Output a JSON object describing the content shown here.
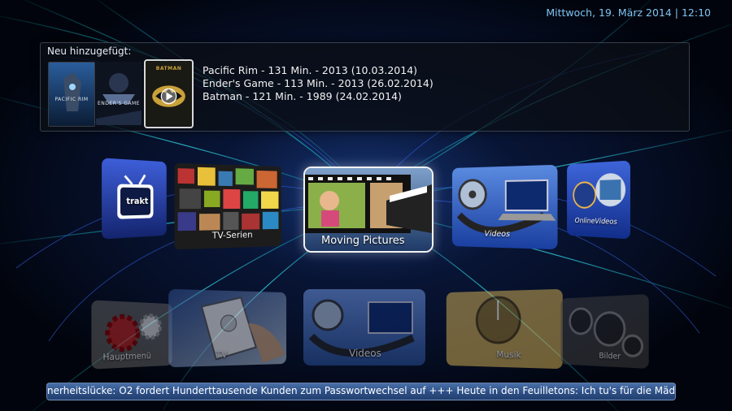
{
  "header": {
    "datetime": "Mittwoch, 19. März 2014 | 12:10"
  },
  "recent": {
    "title": "Neu hinzugefügt:",
    "thumbnails": [
      {
        "caption": "PACIFIC RIM"
      },
      {
        "caption": "ENDER'S GAME"
      },
      {
        "caption": "BATMAN"
      }
    ],
    "items": [
      "Pacific Rim - 131 Min. - 2013 (10.03.2014)",
      "Ender's Game - 113 Min. - 2013 (26.02.2014)",
      "Batman - 121 Min. - 1989 (24.02.2014)"
    ]
  },
  "menu": {
    "tiles": [
      {
        "label": "trakt",
        "icon": "trakt-tv-icon"
      },
      {
        "label": "TV-Serien",
        "icon": "tv-series-collage"
      },
      {
        "label": "Moving Pictures",
        "icon": "film-strip-icon"
      },
      {
        "label": "Videos",
        "icon": "video-reel-icon"
      },
      {
        "label": "OnlineVideos",
        "icon": "globe-video-icon"
      }
    ],
    "lower_tiles": [
      {
        "label": "Hauptmenü",
        "icon": "gears-icon"
      },
      {
        "label": "TV",
        "icon": "remote-control-icon"
      },
      {
        "label": "Videos",
        "icon": "video-reel-icon"
      },
      {
        "label": "Musik",
        "icon": "music-dial-icon"
      },
      {
        "label": "Bilder",
        "icon": "speaker-icon"
      }
    ]
  },
  "ticker": {
    "text": "nerheitslücke: O2 fordert Hunderttausende Kunden zum Passwortwechsel auf +++ Heute in den Feuilletons: Ich tu's für die Mädchen mit I"
  },
  "colors": {
    "accent": "#7fc4f2",
    "ticker_bg": "#3a5f98",
    "background": "#01040c"
  }
}
